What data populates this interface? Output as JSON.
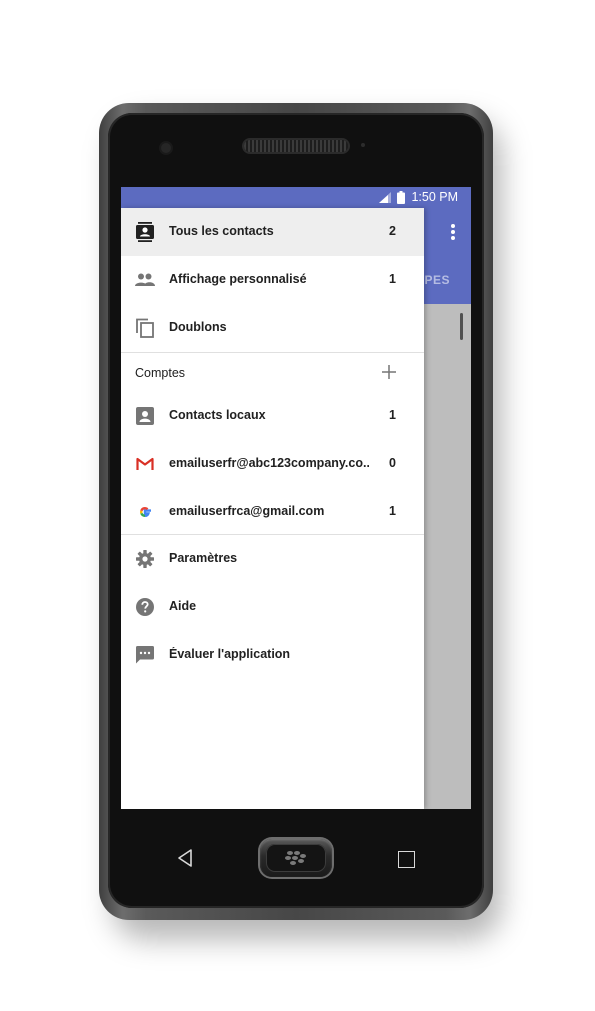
{
  "status_bar": {
    "time": "1:50 PM",
    "icons": [
      "signal-icon",
      "battery-icon"
    ]
  },
  "app_behind": {
    "tab_label_partial": "UPES",
    "menu_icon": "more-vert-icon"
  },
  "drawer": {
    "primary_items": [
      {
        "label": "Tous les contacts",
        "count": "2",
        "icon": "contacts-book-icon",
        "active": true
      },
      {
        "label": "Affichage personnalisé",
        "count": "1",
        "icon": "people-icon",
        "active": false
      },
      {
        "label": "Doublons",
        "count": "",
        "icon": "copy-icon",
        "active": false
      }
    ],
    "accounts_section": {
      "title": "Comptes",
      "add_icon": "plus-icon"
    },
    "accounts": [
      {
        "label": "Contacts locaux",
        "count": "1",
        "icon": "account-box-icon"
      },
      {
        "label": "emailuserfr@abc123company.co...",
        "count": "0",
        "icon": "gmail-icon"
      },
      {
        "label": "emailuserfrca@gmail.com",
        "count": "1",
        "icon": "google-icon"
      }
    ],
    "footer_items": [
      {
        "label": "Paramètres",
        "icon": "gear-icon"
      },
      {
        "label": "Aide",
        "icon": "help-icon"
      },
      {
        "label": "Évaluer l'application",
        "icon": "feedback-icon"
      }
    ]
  },
  "nav_bar": {
    "buttons": [
      "back-icon",
      "home-button",
      "recent-apps-icon"
    ]
  },
  "colors": {
    "primary": "#5c6bc0",
    "icon_gray": "#757575",
    "text": "#212121",
    "scrim": "#bdbdbd"
  }
}
